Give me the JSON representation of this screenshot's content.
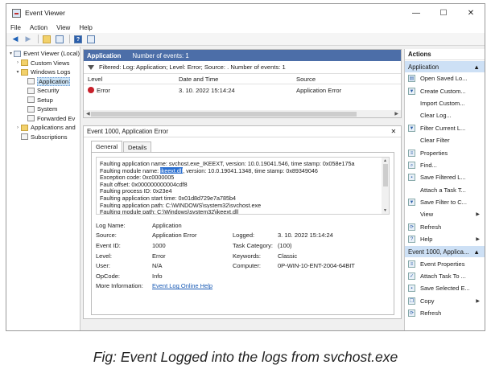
{
  "window": {
    "title": "Event Viewer",
    "minimize": "—",
    "maximize": "☐",
    "close": "✕"
  },
  "menu": [
    "File",
    "Action",
    "View",
    "Help"
  ],
  "tree": [
    {
      "label": "Event Viewer (Local)",
      "arrow": "▾",
      "indent": 0,
      "icon": "computer-icon"
    },
    {
      "label": "Custom Views",
      "arrow": "›",
      "indent": 1,
      "icon": "folder-icon"
    },
    {
      "label": "Windows Logs",
      "arrow": "▾",
      "indent": 1,
      "icon": "folder-icon"
    },
    {
      "label": "Application",
      "arrow": "",
      "indent": 2,
      "icon": "log-icon",
      "selected": true
    },
    {
      "label": "Security",
      "arrow": "",
      "indent": 2,
      "icon": "log-icon"
    },
    {
      "label": "Setup",
      "arrow": "",
      "indent": 2,
      "icon": "log-icon"
    },
    {
      "label": "System",
      "arrow": "",
      "indent": 2,
      "icon": "log-icon"
    },
    {
      "label": "Forwarded Ev",
      "arrow": "",
      "indent": 2,
      "icon": "log-icon"
    },
    {
      "label": "Applications and",
      "arrow": "›",
      "indent": 1,
      "icon": "folder-icon"
    },
    {
      "label": "Subscriptions",
      "arrow": "",
      "indent": 1,
      "icon": "log-icon"
    }
  ],
  "log_panel": {
    "name": "Application",
    "count": "Number of events: 1",
    "filter": "Filtered: Log: Application; Level: Error; Source: . Number of events: 1",
    "columns": {
      "level": "Level",
      "date": "Date and Time",
      "source": "Source"
    },
    "events": [
      {
        "level": "Error",
        "date": "3. 10. 2022 15:14:24",
        "source": "Application Error"
      }
    ]
  },
  "detail": {
    "title": "Event 1000, Application Error",
    "close": "✕",
    "tabs": [
      "General",
      "Details"
    ],
    "desc_lines": [
      [
        "Faulting application name: svchost.exe_IKEEXT, version: 10.0.19041.546, time stamp: 0x058e175a"
      ],
      [
        "Faulting module name: ",
        "ikeext.dll",
        ", version: 10.0.19041.1348, time stamp: 0x89349046"
      ],
      [
        "Exception code: 0xc0000005"
      ],
      [
        "Fault offset: 0x000000000004cdf8"
      ],
      [
        "Faulting process ID: 0x23e4"
      ],
      [
        "Faulting application start time: 0x01d8d729e7a785b4"
      ],
      [
        "Faulting application path: C:\\WINDOWS\\system32\\svchost.exe"
      ],
      [
        "Faulting module path: C:\\Windows\\system32\\ikeext.dll"
      ]
    ],
    "props": {
      "log_name_label": "Log Name:",
      "log_name": "Application",
      "source_label": "Source:",
      "source": "Application Error",
      "logged_label": "Logged:",
      "logged": "3. 10. 2022 15:14:24",
      "event_id_label": "Event ID:",
      "event_id": "1000",
      "task_label": "Task Category:",
      "task": "(100)",
      "level_label": "Level:",
      "level": "Error",
      "keywords_label": "Keywords:",
      "keywords": "Classic",
      "user_label": "User:",
      "user": "N/A",
      "computer_label": "Computer:",
      "computer": "0P-WIN-10-ENT-2004-64BIT",
      "opcode_label": "OpCode:",
      "opcode": "Info",
      "more_label": "More Information:",
      "more_link": "Event Log Online Help"
    }
  },
  "actions": {
    "header": "Actions",
    "section1": "Application",
    "items1": [
      {
        "label": "Open Saved Lo...",
        "icon": "folder-open-icon"
      },
      {
        "label": "Create Custom...",
        "icon": "filter-icon"
      },
      {
        "label": "Import Custom...",
        "icon": ""
      },
      {
        "label": "Clear Log...",
        "icon": ""
      },
      {
        "label": "Filter Current L...",
        "icon": "filter-icon"
      },
      {
        "label": "Clear Filter",
        "icon": ""
      },
      {
        "label": "Properties",
        "icon": "properties-icon"
      },
      {
        "label": "Find...",
        "icon": "find-icon"
      },
      {
        "label": "Save Filtered L...",
        "icon": "save-icon"
      },
      {
        "label": "Attach a Task T...",
        "icon": ""
      },
      {
        "label": "Save Filter to C...",
        "icon": "filter-icon"
      },
      {
        "label": "View",
        "icon": "",
        "submenu": true
      },
      {
        "label": "Refresh",
        "icon": "refresh-icon"
      },
      {
        "label": "Help",
        "icon": "help-icon",
        "submenu": true
      }
    ],
    "section2": "Event 1000, Applica...",
    "items2": [
      {
        "label": "Event Properties",
        "icon": "properties-icon"
      },
      {
        "label": "Attach Task To ...",
        "icon": "task-icon"
      },
      {
        "label": "Save Selected E...",
        "icon": "save-icon"
      },
      {
        "label": "Copy",
        "icon": "copy-icon",
        "submenu": true
      },
      {
        "label": "Refresh",
        "icon": "refresh-icon"
      }
    ]
  },
  "caption": "Fig: Event Logged into the logs from svchost.exe"
}
